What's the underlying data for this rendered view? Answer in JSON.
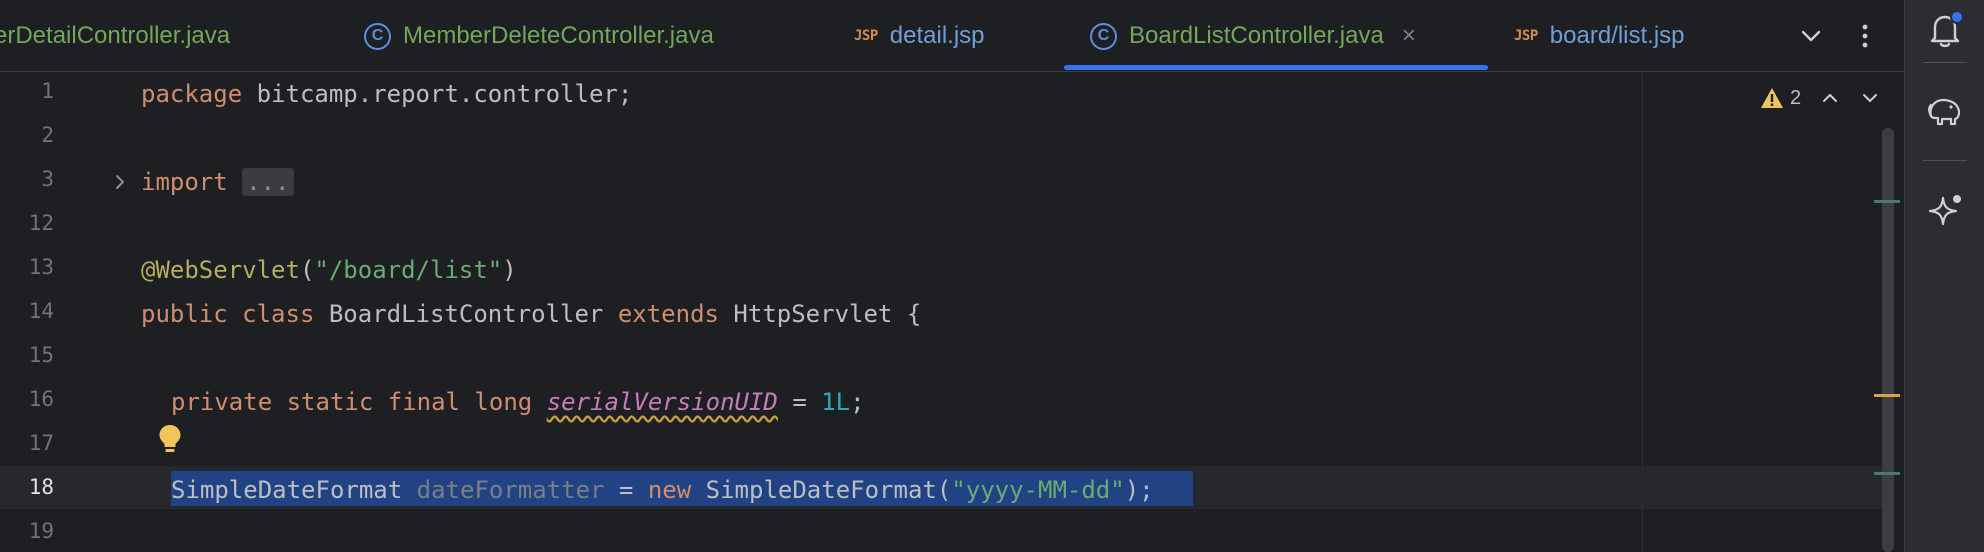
{
  "tabs": [
    {
      "label": "erDetailController.java",
      "icon": "class-icon",
      "color": "green",
      "active": false
    },
    {
      "label": "MemberDeleteController.java",
      "icon": "class-icon",
      "color": "green",
      "active": false
    },
    {
      "label": "detail.jsp",
      "icon": "jsp-icon",
      "color": "blue",
      "active": false
    },
    {
      "label": "BoardListController.java",
      "icon": "class-icon",
      "color": "green",
      "active": true
    },
    {
      "label": "board/list.jsp",
      "icon": "jsp-icon",
      "color": "blue",
      "active": false
    }
  ],
  "icons": {
    "class_glyph": "C",
    "jsp_glyph": "JSP",
    "close_glyph": "×"
  },
  "inspection": {
    "warning_count": "2"
  },
  "editor": {
    "line_numbers": [
      "1",
      "2",
      "3",
      "12",
      "13",
      "14",
      "15",
      "16",
      "17",
      "18",
      "19"
    ],
    "current_line": "18",
    "folded_placeholder": "...",
    "lines": {
      "l1_kw": "package",
      "l1_rest": " bitcamp.report.controller;",
      "l3_kw": "import",
      "l13_annotation": "@WebServlet",
      "l13_open": "(",
      "l13_string": "\"/board/list\"",
      "l13_close": ")",
      "l14_kw1": "public class",
      "l14_name": " BoardListController ",
      "l14_kw2": "extends",
      "l14_rest": " HttpServlet {",
      "l16_kw": "private static final long",
      "l16_field": "serialVersionUID",
      "l16_eq": " = ",
      "l16_num": "1L",
      "l16_semi": ";",
      "l18_type": "SimpleDateFormat ",
      "l18_field": "dateFormatter",
      "l18_eq": " = ",
      "l18_kw": "new",
      "l18_ctor": " SimpleDateFormat(",
      "l18_string": "\"yyyy-MM-dd\"",
      "l18_end": ");"
    }
  },
  "colors": {
    "accent": "#3574f0",
    "selection": "#214283",
    "keyword": "#cf8e6d",
    "string": "#6aab73",
    "number": "#2aacb8",
    "annotation": "#b3ae60",
    "warning": "#f2c55c",
    "notification_dot": "#3574f0"
  }
}
